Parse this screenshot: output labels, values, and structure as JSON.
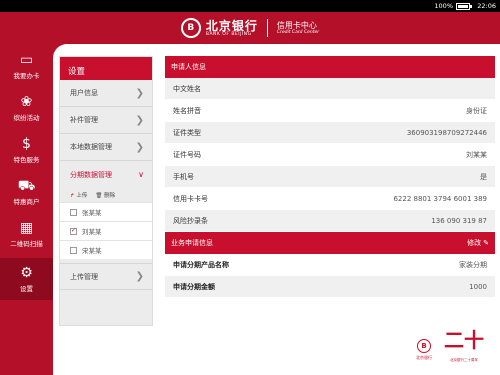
{
  "status_bar": {
    "battery": "100%",
    "time": "22:06"
  },
  "header": {
    "bank_cn": "北京银行",
    "bank_en": "BANK OF BEIJING",
    "center_cn": "信用卡中心",
    "center_en": "Credit Card Center",
    "logo_glyph": "B"
  },
  "nav": [
    {
      "label": "我要办卡",
      "icon": "card-icon",
      "glyph": "▭"
    },
    {
      "label": "缤纷活动",
      "icon": "gift-basket-icon",
      "glyph": "❀"
    },
    {
      "label": "特色服务",
      "icon": "service-badge-icon",
      "glyph": "$"
    },
    {
      "label": "特惠商户",
      "icon": "shopping-cart-icon",
      "glyph": "⛟"
    },
    {
      "label": "二维码扫描",
      "icon": "qr-code-icon",
      "glyph": "▦"
    },
    {
      "label": "设置",
      "icon": "gear-icon",
      "glyph": "⚙"
    }
  ],
  "settings": {
    "title": "设置",
    "items": [
      {
        "label": "用户信息"
      },
      {
        "label": "补件管理"
      },
      {
        "label": "本地数据管理"
      },
      {
        "label": "分期数据管理"
      }
    ],
    "upload_label": "上传",
    "delete_label": "删除",
    "sub_items": [
      {
        "label": "张某某",
        "checked": false
      },
      {
        "label": "刘某某",
        "checked": true
      },
      {
        "label": "宋某某",
        "checked": false
      }
    ],
    "upload_manage_label": "上传管理"
  },
  "applicant": {
    "section_title": "申请人信息",
    "rows": [
      {
        "label": "中文姓名",
        "value": ""
      },
      {
        "label": "姓名拼音",
        "value": "身份证"
      },
      {
        "label": "证件类型",
        "value": "360903198709272446"
      },
      {
        "label": "证件号码",
        "value": "刘某某"
      },
      {
        "label": "手机号",
        "value": "是"
      },
      {
        "label": "信用卡卡号",
        "value": "6222 8801 3794 6001 389"
      },
      {
        "label": "风险抄录条",
        "value": "136 090 319 87"
      }
    ]
  },
  "business": {
    "section_title": "业务申请信息",
    "edit_label": "修改",
    "rows": [
      {
        "label": "申请分期产品名称",
        "value": "家装分期"
      },
      {
        "label": "申请分期金额",
        "value": "1000"
      }
    ]
  },
  "footer": {
    "logo_text": "北京银行",
    "anniversary_glyph": "二十",
    "anniversary_text": "北京银行二十周年"
  }
}
